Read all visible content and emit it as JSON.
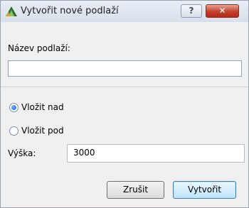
{
  "window": {
    "title": "Vytvořit nové podlaží",
    "help_label": "?",
    "close_label": "✕"
  },
  "form": {
    "name_label": "Název podlaží:",
    "name_value": "",
    "insert_above_label": "Vložit nad",
    "insert_above_checked": true,
    "insert_below_label": "Vložit pod",
    "insert_below_checked": false,
    "height_label": "Výška:",
    "height_value": "3000"
  },
  "buttons": {
    "cancel_label": "Zrušit",
    "create_label": "Vytvořit"
  },
  "colors": {
    "accent": "#1c5ec4",
    "close_button": "#c2402c"
  }
}
